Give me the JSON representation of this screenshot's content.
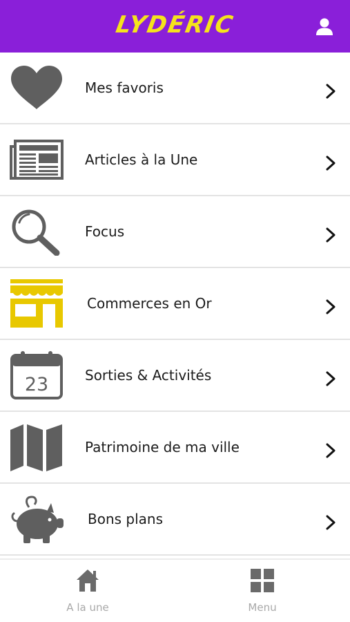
{
  "header": {
    "brand": "LYDÉRIC",
    "user_icon": "user-icon",
    "background": "#8a1fd9",
    "brand_color": "#f5e31c"
  },
  "menu": {
    "items": [
      {
        "label": "Mes favoris",
        "icon": "heart-icon"
      },
      {
        "label": "Articles à la Une",
        "icon": "newspaper-icon"
      },
      {
        "label": "Focus",
        "icon": "magnifier-icon"
      },
      {
        "label": "Commerces en Or",
        "icon": "shop-icon"
      },
      {
        "label": "Sorties & Activités",
        "icon": "calendar-icon"
      },
      {
        "label": "Patrimoine de ma ville",
        "icon": "map-icon"
      },
      {
        "label": "Bons plans",
        "icon": "piggy-bank-icon"
      }
    ],
    "calendar_day": "23",
    "chevron_icon": "chevron-right-icon",
    "icon_color": "#5f5f5f",
    "shop_icon_color": "#e8c800"
  },
  "tabbar": {
    "tabs": [
      {
        "label": "A la une",
        "icon": "home-icon"
      },
      {
        "label": "Menu",
        "icon": "grid-icon"
      }
    ],
    "icon_color": "#6a6a6a",
    "label_color": "#a8a8a8"
  }
}
